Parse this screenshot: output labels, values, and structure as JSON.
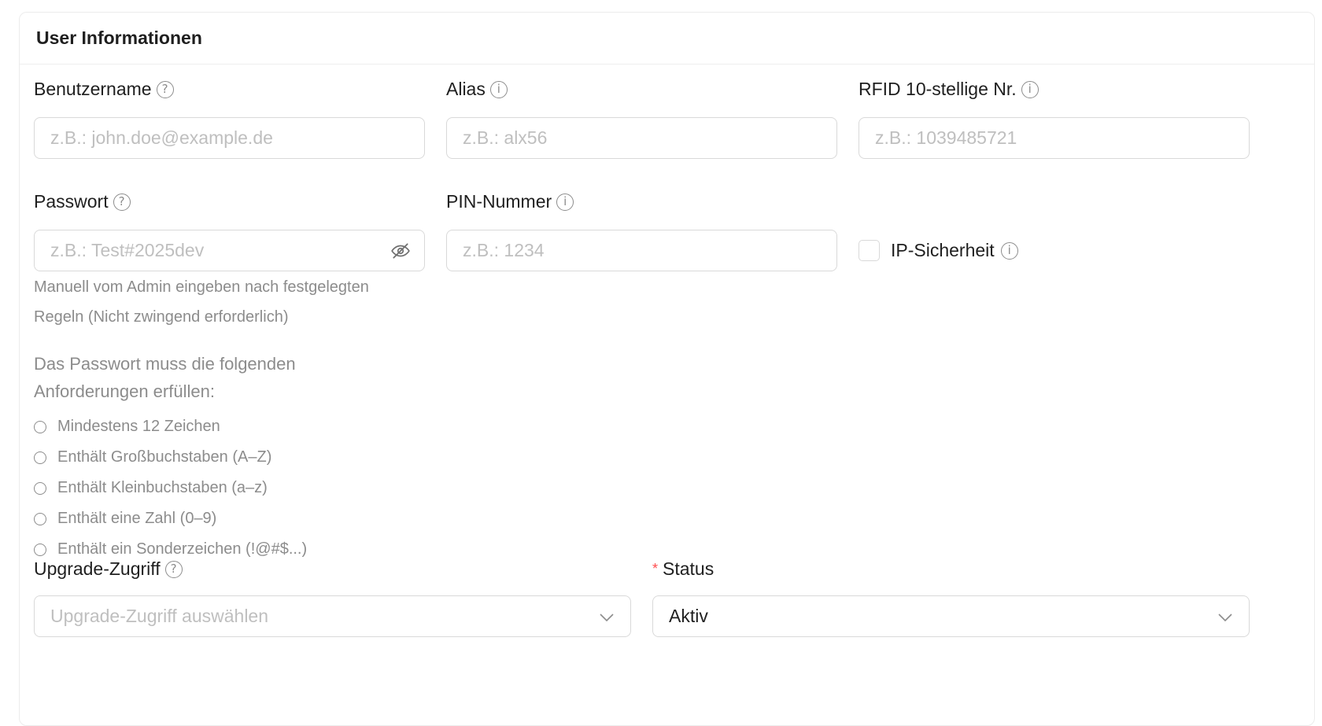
{
  "card": {
    "title": "User Informationen"
  },
  "fields": {
    "username": {
      "label": "Benutzername",
      "placeholder": "z.B.: john.doe@example.de",
      "value": ""
    },
    "alias": {
      "label": "Alias",
      "placeholder": "z.B.: alx56",
      "value": ""
    },
    "rfid": {
      "label": "RFID 10-stellige Nr.",
      "placeholder": "z.B.: 1039485721",
      "value": ""
    },
    "password": {
      "label": "Passwort",
      "placeholder": "z.B.: Test#2025dev",
      "value": "",
      "help_line1": "Manuell vom Admin eingeben nach festgelegten",
      "help_line2": "Regeln (Nicht zwingend erforderlich)",
      "requirements_title_line1": "Das Passwort muss die folgenden",
      "requirements_title_line2": "Anforderungen erfüllen:",
      "requirements": [
        "Mindestens 12 Zeichen",
        "Enthält Großbuchstaben (A–Z)",
        "Enthält Kleinbuchstaben (a–z)",
        "Enthält eine Zahl (0–9)",
        "Enthält ein Sonderzeichen (!@#$...)"
      ]
    },
    "pin": {
      "label": "PIN-Nummer",
      "placeholder": "z.B.: 1234",
      "value": ""
    },
    "ip_security": {
      "label": "IP-Sicherheit",
      "checked": false
    },
    "upgrade_access": {
      "label": "Upgrade-Zugriff",
      "placeholder": "Upgrade-Zugriff auswählen"
    },
    "status": {
      "label": "Status",
      "required_mark": "*",
      "value": "Aktiv"
    }
  },
  "icons": {
    "question": "question-circle-icon",
    "info": "info-circle-icon",
    "eye_off": "eye-off-icon",
    "chevron": "chevron-down-icon"
  },
  "colors": {
    "text": "#1f1f1f",
    "muted": "#8c8c8c",
    "placeholder": "#bfbfbf",
    "border": "#d9d9d9",
    "required": "#ff4d4f"
  }
}
